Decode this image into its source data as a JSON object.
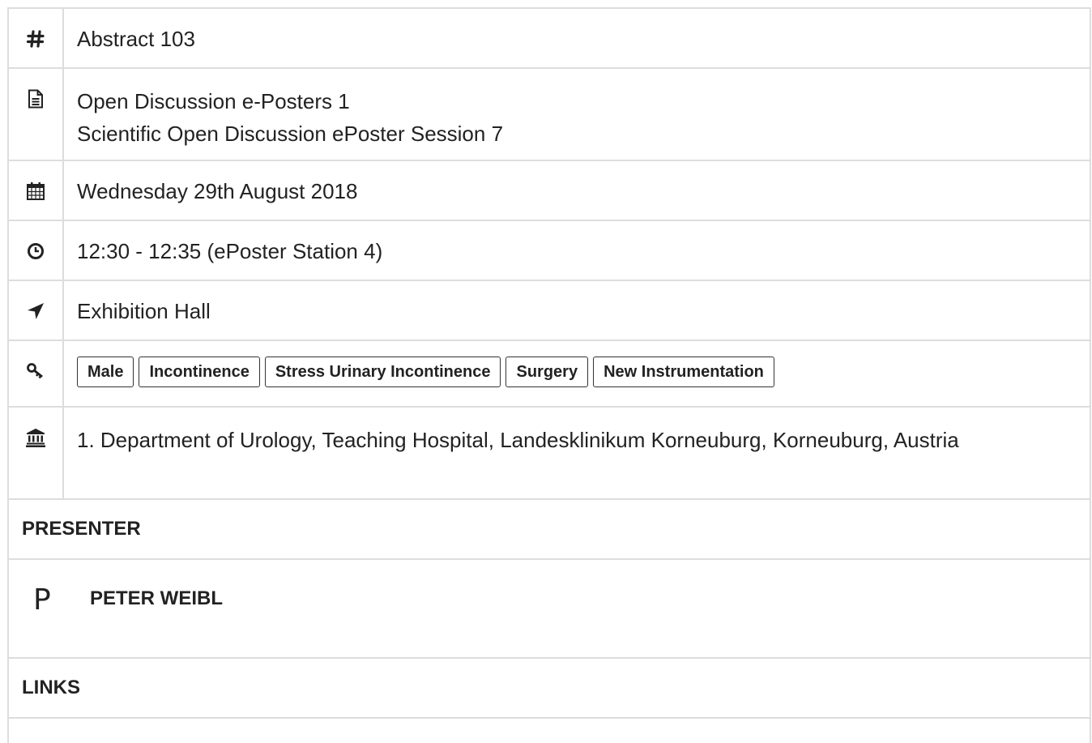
{
  "abstract": {
    "icon": "hash-icon",
    "label": "Abstract 103"
  },
  "session": {
    "icon": "document-icon",
    "line1": "Open Discussion e-Posters 1",
    "line2": "Scientific Open Discussion ePoster Session 7"
  },
  "date": {
    "icon": "calendar-icon",
    "label": "Wednesday 29th August 2018"
  },
  "time": {
    "icon": "clock-icon",
    "label": "12:30 - 12:35 (ePoster Station 4)"
  },
  "location": {
    "icon": "location-arrow-icon",
    "label": "Exhibition Hall"
  },
  "keywords": {
    "icon": "key-icon",
    "tags": [
      "Male",
      "Incontinence",
      "Stress Urinary Incontinence",
      "Surgery",
      "New Instrumentation"
    ]
  },
  "institution": {
    "icon": "institution-icon",
    "label": "1. Department of Urology, Teaching Hospital, Landesklinikum Korneuburg, Korneuburg, Austria"
  },
  "presenter": {
    "heading": "PRESENTER",
    "initial": "P",
    "name": "PETER WEIBL"
  },
  "links": {
    "heading": "LINKS"
  }
}
